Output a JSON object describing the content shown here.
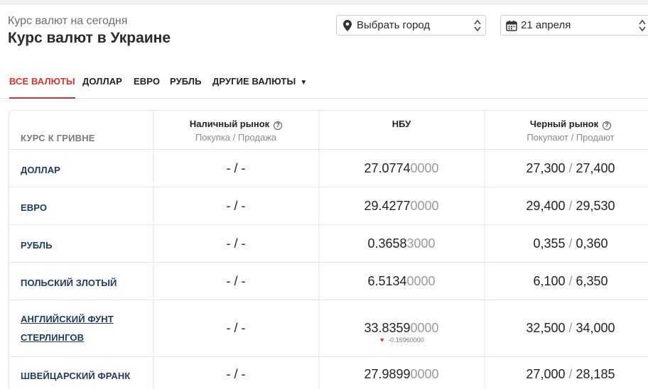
{
  "header": {
    "subtitle": "Курс валют на сегодня",
    "title": "Курс валют в Украине"
  },
  "filters": {
    "city": {
      "label": "Выбрать город",
      "icon": "map-pin-icon"
    },
    "date": {
      "label": "21 апреля",
      "icon": "calendar-icon"
    }
  },
  "tabs": [
    {
      "label": "ВСЕ ВАЛЮТЫ",
      "active": true
    },
    {
      "label": "ДОЛЛАР"
    },
    {
      "label": "ЕВРО"
    },
    {
      "label": "РУБЛЬ"
    },
    {
      "label": "ДРУГИЕ ВАЛЮТЫ",
      "dropdown": "▼"
    }
  ],
  "table": {
    "header": {
      "currency_col": "КУРС К ГРИВНЕ",
      "cash": {
        "title": "Наличный рынок",
        "sub": "Покупка / Продажа"
      },
      "nbu": {
        "title": "НБУ"
      },
      "black": {
        "title": "Черный рынок",
        "sub": "Покупают / Продают"
      }
    },
    "rows": [
      {
        "name": "ДОЛЛАР",
        "cash": "- / -",
        "nbu_main": "27.0774",
        "nbu_dim": "0000",
        "black_buy": "27,300",
        "slash": " / ",
        "black_sell": "27,400"
      },
      {
        "name": "ЕВРО",
        "cash": "- / -",
        "nbu_main": "29.4277",
        "nbu_dim": "0000",
        "black_buy": "29,400",
        "slash": " / ",
        "black_sell": "29,530"
      },
      {
        "name": "РУБЛЬ",
        "cash": "- / -",
        "nbu_main": "0.3658",
        "nbu_dim": "3000",
        "black_buy": "0,355",
        "slash": " / ",
        "black_sell": "0,360"
      },
      {
        "name": "ПОЛЬСКИЙ ЗЛОТЫЙ",
        "cash": "- / -",
        "nbu_main": "6.5134",
        "nbu_dim": "0000",
        "black_buy": "6,100",
        "slash": " / ",
        "black_sell": "6,350"
      },
      {
        "name": "АНГЛИЙСКИЙ ФУНТ СТЕРЛИНГОВ",
        "cash": "- / -",
        "nbu_main": "33.8359",
        "nbu_dim": "0000",
        "nbu_delta": "-0.16960000",
        "black_buy": "32,500",
        "slash": " / ",
        "black_sell": "34,000"
      },
      {
        "name": "ШВЕЙЦАРСКИЙ ФРАНК",
        "cash": "- / -",
        "nbu_main": "27.9899",
        "nbu_dim": "0000",
        "black_buy": "27,000",
        "slash": " / ",
        "black_sell": "28,185"
      }
    ]
  },
  "colors": {
    "accent": "#d9342b",
    "currency_link": "#1e3a5f"
  }
}
